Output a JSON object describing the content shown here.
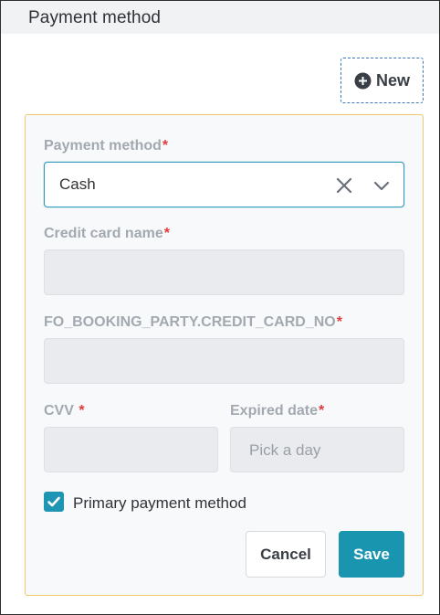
{
  "header": {
    "title": "Payment method"
  },
  "toolbar": {
    "new_label": "New",
    "new_icon": "plus-circle-icon"
  },
  "form": {
    "payment_method": {
      "label": "Payment method",
      "required_mark": "*",
      "value": "Cash"
    },
    "credit_card_name": {
      "label": "Credit card name",
      "required_mark": "*",
      "value": ""
    },
    "credit_card_no": {
      "label": "FO_BOOKING_PARTY.CREDIT_CARD_NO",
      "required_mark": "*",
      "value": ""
    },
    "cvv": {
      "label": "CVV ",
      "required_mark": "*",
      "value": ""
    },
    "expired_date": {
      "label": "Expired date",
      "required_mark": "*",
      "placeholder": "Pick a day"
    },
    "primary": {
      "label": "Primary payment method",
      "checked": true
    },
    "cancel_label": "Cancel",
    "save_label": "Save"
  },
  "colors": {
    "accent": "#1a95b0",
    "required": "#e03c3c",
    "card_border": "#f0c96a",
    "dashed_border": "#3b76b8"
  }
}
